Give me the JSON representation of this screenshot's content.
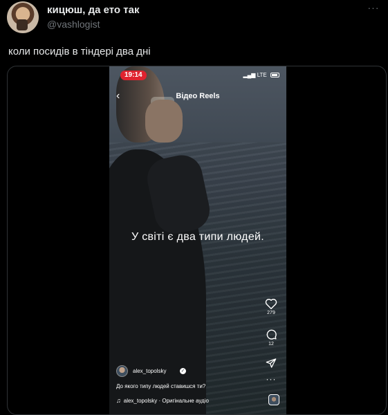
{
  "tweet": {
    "display_name": "кицюш, да ето так",
    "handle": "@vashlogist",
    "text": "коли посидів в тіндері два дні",
    "more_icon": "more-horizontal-icon"
  },
  "reel": {
    "status_time": "19:14",
    "network": "LTE",
    "header_title": "Відео Reels",
    "overlay_text": "У світі є два типи людей.",
    "likes": "279",
    "comments": "12",
    "author": "alex_topolsky",
    "caption": "До якого типу людей ставишся ти?",
    "audio": "alex_topolsky · Оригінальне аудіо",
    "accent_color": "#e0232f"
  }
}
